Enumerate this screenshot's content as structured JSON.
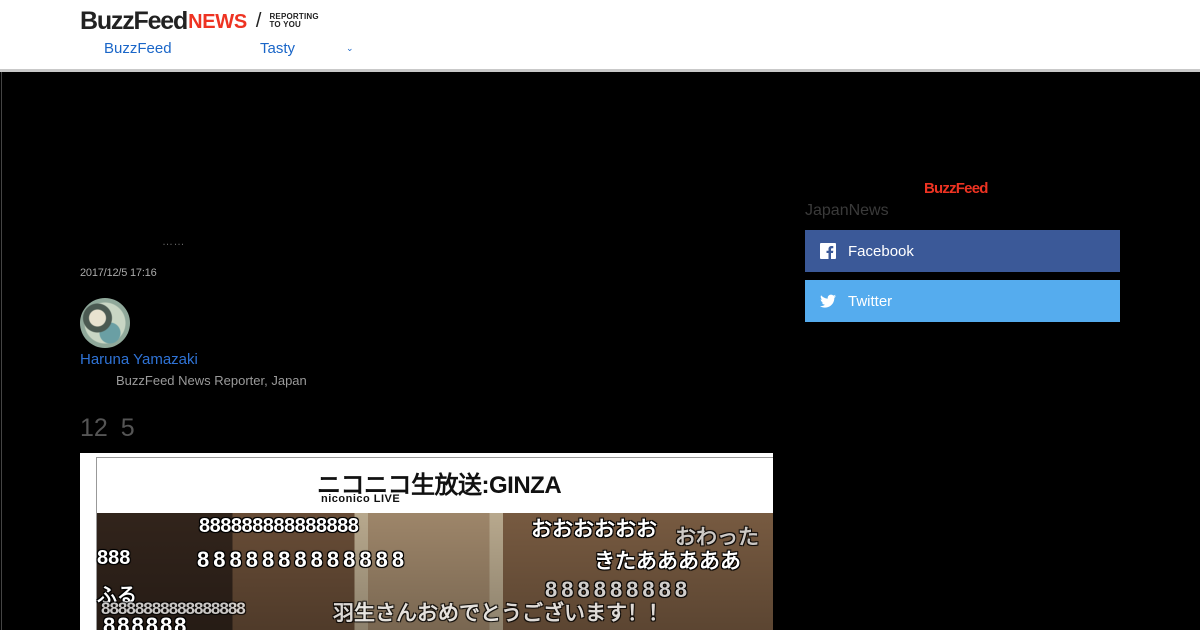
{
  "header": {
    "brand_main": "BuzzFeed",
    "brand_news": "NEWS",
    "brand_slash": "/",
    "brand_tagline": "REPORTING\nTO YOU",
    "nav": [
      {
        "label": "BuzzFeed"
      },
      {
        "label": "Tasty"
      }
    ],
    "nav_more_icon": "chevron-down-icon",
    "nav_more_glyph": "⌄"
  },
  "article": {
    "ellipsis": "……",
    "timestamp": "2017/12/5 17:16",
    "author": {
      "name": "Haruna Yamazaki",
      "role": "BuzzFeed News Reporter, Japan"
    },
    "date_heading": "12 5"
  },
  "video": {
    "title": "ニコニコ生放送:GINZA",
    "subtitle": "niconico LIVE",
    "comments": [
      "888888888888888",
      "おおおおおお",
      "おわった",
      "888",
      "8888888888888",
      "きたあああああ",
      "ふる",
      "888888888",
      "88888888888888888",
      "羽生さんおめでとうございます！！",
      "888888"
    ]
  },
  "sidebar": {
    "logo": "BuzzFeed",
    "label": "JapanNews",
    "share": [
      {
        "label": "Facebook",
        "icon": "facebook-icon",
        "color": "#3b5998"
      },
      {
        "label": "Twitter",
        "icon": "twitter-icon",
        "color": "#55acee"
      }
    ]
  },
  "colors": {
    "brand_red": "#ee3322",
    "link_blue": "#2f73d6",
    "background": "#000000"
  }
}
